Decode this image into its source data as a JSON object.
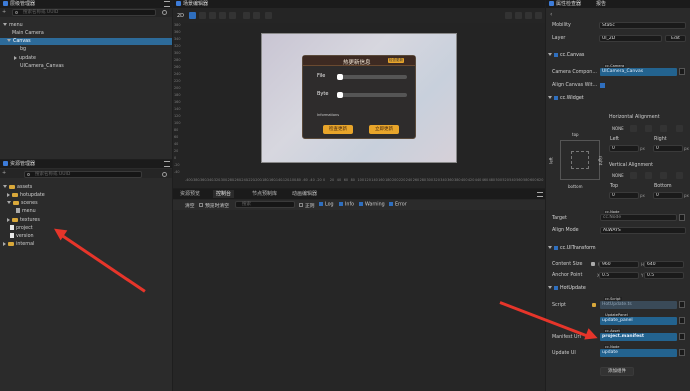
{
  "hierarchy": {
    "title": "层级管理器",
    "search_placeholder": "搜索名称或 UUID",
    "items": [
      "menu",
      "Main Camera",
      "Canvas",
      "bg",
      "update",
      "UICamera_Canvas"
    ]
  },
  "assets": {
    "title": "资源管理器",
    "search_placeholder": "搜索名称或 UUID",
    "items": [
      "assets",
      "hotupdate",
      "scenes",
      "menu",
      "textures",
      "project",
      "version",
      "internal"
    ]
  },
  "scene": {
    "title": "场景编辑器",
    "mode": "2D",
    "y_ticks": [
      "380",
      "360",
      "340",
      "320",
      "300",
      "280",
      "260",
      "240",
      "220",
      "200",
      "180",
      "160",
      "140",
      "120",
      "100",
      "80",
      "60",
      "40",
      "20",
      "0",
      "-20",
      "-40"
    ],
    "x_ticks": [
      "-400",
      "-380",
      "-360",
      "-340",
      "-320",
      "-300",
      "-280",
      "-260",
      "-240",
      "-220",
      "-200",
      "-180",
      "-160",
      "-140",
      "-120",
      "-100",
      "-80",
      "-60",
      "-40",
      "-20",
      "0",
      "20",
      "40",
      "60",
      "80",
      "100",
      "120",
      "140",
      "160",
      "180",
      "200",
      "220",
      "240",
      "260",
      "280",
      "300",
      "320",
      "340",
      "360",
      "380",
      "400",
      "420",
      "440",
      "460",
      "480",
      "500",
      "520",
      "540",
      "560",
      "580",
      "600",
      "620"
    ],
    "dialog": {
      "title": "热更新信息",
      "badge": "检查更新",
      "file_label": "File",
      "byte_label": "Byte",
      "file_progress": 0.0,
      "byte_progress": 0.0,
      "info_label": "Informations",
      "check_btn": "检查更新",
      "update_btn": "立即更新"
    }
  },
  "console": {
    "tabs": [
      "资源预览",
      "控制台",
      "节点预制库",
      "动画编辑器"
    ],
    "clear": "清空",
    "clear_on_play": "预览时清空",
    "search_placeholder": "搜索",
    "regex": "正则",
    "filters": [
      "Log",
      "Info",
      "Warning",
      "Error"
    ]
  },
  "inspector": {
    "title": "属性检查器",
    "top_tab": "报告",
    "mobility_label": "Mobility",
    "mobility_value": "Static",
    "layer_label": "Layer",
    "layer_value": "UI_2D",
    "edit": "Edit",
    "canvas": {
      "name": "cc.Canvas",
      "camera_label": "Camera Compon...",
      "camera_type": "cc.Camera",
      "camera_value": "UICamera_Canvas",
      "align_label": "Align Canvas Wit..."
    },
    "widget": {
      "name": "cc.Widget",
      "h_align": "Horizontal Alignment",
      "none": "NONE",
      "left": "Left",
      "right": "Right",
      "left_val": "0",
      "right_val": "0",
      "px": "px",
      "top": "top",
      "bottom": "bottom",
      "left_side": "left",
      "right_side": "right",
      "v_align": "Vertical Alignment",
      "top_lbl": "Top",
      "bottom_lbl": "Bottom",
      "top_val": "0",
      "bottom_val": "0",
      "target_label": "Target",
      "target_type": "cc.Node",
      "target_value": "cc.Node",
      "align_mode_label": "Align Mode",
      "align_mode_value": "ALWAYS"
    },
    "transform": {
      "name": "cc.UITransform",
      "content_size_label": "Content Size",
      "w_label": "W",
      "w": "960",
      "h_label": "H",
      "h": "640",
      "anchor_label": "Anchor Point",
      "x_label": "X",
      "ax": "0.5",
      "y_label": "Y",
      "ay": "0.5"
    },
    "hotupdate": {
      "name": "HotUpdate",
      "script_label": "Script",
      "script_type": "cc.Script",
      "script_value": "HotUpdate.ts",
      "panel_type": "UpdatePanel",
      "panel_value": "update_panel",
      "manifest_label": "Manifest Url",
      "manifest_type": "cc.Asset",
      "manifest_value": "project.manifest",
      "update_ui_label": "Update UI",
      "update_ui_type": "cc.Node",
      "update_ui_value": "update"
    },
    "add_component": "添加组件"
  },
  "colors": {
    "accent": "#2d6b9a",
    "arrow": "#e6352a",
    "folder": "#d9a83a",
    "dialog_button": "#e8a52a"
  }
}
